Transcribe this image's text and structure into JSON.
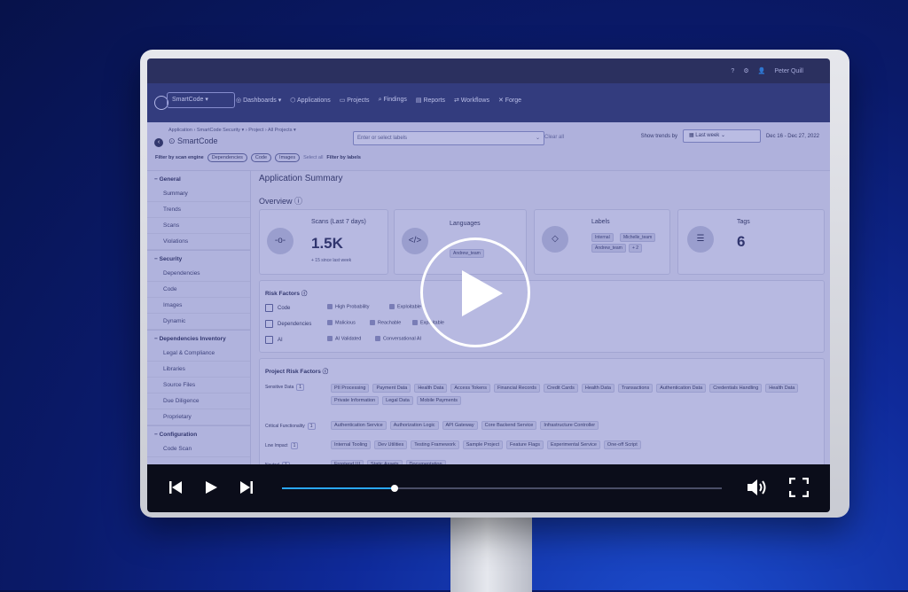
{
  "top": {
    "user": "Peter Quill"
  },
  "nav": {
    "app_selector": "SmartCode",
    "items": [
      "Dashboards",
      "Applications",
      "Projects",
      "Findings",
      "Reports",
      "Workflows",
      "Forge"
    ]
  },
  "appbar": {
    "breadcrumb": [
      "Application",
      "SmartCode Security",
      "Project",
      "All Projects"
    ],
    "title": "SmartCode",
    "filter_engine_label": "Filter by scan engine",
    "engine_chips": [
      "Dependencies",
      "Code",
      "Images"
    ],
    "select_all": "Select all",
    "filter_labels_label": "Filter by labels",
    "labels_placeholder": "Enter or select labels",
    "clear_all": "Clear all",
    "trends_label": "Show trends by",
    "trends_value": "Last week",
    "date_range": "Dec 16 - Dec 27, 2022"
  },
  "sidebar": {
    "sections": [
      {
        "title": "General",
        "items": [
          "Summary",
          "Trends",
          "Scans",
          "Violations"
        ]
      },
      {
        "title": "Security",
        "items": [
          "Dependencies",
          "Code",
          "Images",
          "Dynamic"
        ]
      },
      {
        "title": "Dependencies Inventory",
        "items": [
          "Legal & Compliance",
          "Libraries",
          "Source Files",
          "Due Diligence",
          "Proprietary"
        ]
      },
      {
        "title": "Configuration",
        "items": [
          "Code Scan"
        ]
      }
    ]
  },
  "main": {
    "title": "Application Summary",
    "overview": "Overview",
    "scans": {
      "title": "Scans (Last 7 days)",
      "value": "1.5K",
      "delta": "+ 15 since last week"
    },
    "languages": {
      "title": "Languages",
      "tags": [
        "Andrew_team"
      ]
    },
    "labels": {
      "title": "Labels",
      "tags": [
        "Internal",
        "Michelle_team",
        "Andrew_team",
        "+ 2"
      ]
    },
    "tags": {
      "title": "Tags",
      "value": "6"
    },
    "risk_factors": {
      "title": "Risk Factors",
      "rows": [
        {
          "name": "Code",
          "tags": [
            "High Probability",
            "Exploitable"
          ]
        },
        {
          "name": "Dependencies",
          "tags": [
            "Malicious",
            "Reachable",
            "Exploitable"
          ]
        },
        {
          "name": "AI",
          "tags": [
            "AI Validated",
            "Conversational AI"
          ]
        }
      ]
    },
    "project_risk": {
      "title": "Project Risk Factors",
      "categories": [
        {
          "name": "Sensitive Data",
          "count": "1",
          "tags": [
            "PII Processing",
            "Payment Data",
            "Health Data",
            "Access Tokens",
            "Financial Records",
            "Credit Cards",
            "Health Data",
            "Transactions",
            "Authentication Data",
            "Credentials Handling",
            "Health Data",
            "Private Information",
            "Legal Data",
            "Mobile Payments"
          ]
        },
        {
          "name": "Critical Functionality",
          "count": "1",
          "tags": [
            "Authentication Service",
            "Authorization Logic",
            "API Gateway",
            "Core Backend Service",
            "Infrastructure Controller"
          ]
        },
        {
          "name": "Low Impact",
          "count": "1",
          "tags": [
            "Internal Tooling",
            "Dev Utilities",
            "Testing Framework",
            "Sample Project",
            "Feature Flags",
            "Experimental Service",
            "One-off Script"
          ]
        },
        {
          "name": "Neutral",
          "count": "1",
          "tags": [
            "Frontend UI",
            "Static Assets",
            "Documentation"
          ]
        }
      ]
    }
  },
  "video": {
    "progress": 0.256
  }
}
